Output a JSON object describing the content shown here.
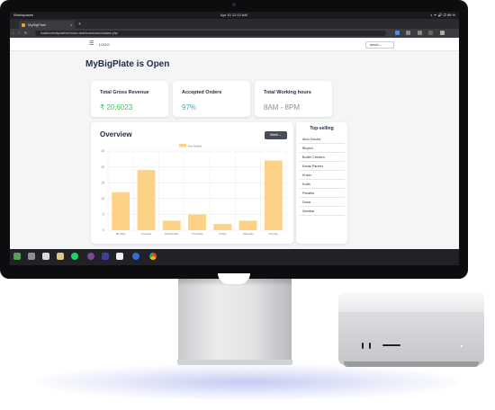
{
  "os": {
    "workspace_label": "Workspaces",
    "clock": "Apr 10  12:12 AM",
    "tray": "◐ ᯤ 🔊 ⏻ 98 %"
  },
  "browser": {
    "tab_title": "MyBigPlate",
    "new_tab": "+",
    "close_tab": "x",
    "nav_buttons": "‹ › ↻",
    "url": "localhost/mbp/admin/index-dashboard/admin/sales.php"
  },
  "app": {
    "logo": "LOGO",
    "admin_label": "admin",
    "page_title": "MyBigPlate is Open",
    "cards": [
      {
        "title": "Total Gross Revenue",
        "value": "₹ 20,6023",
        "color": "#35c55a"
      },
      {
        "title": "Accepted Orders",
        "value": "97%",
        "color": "#2fb8c9"
      },
      {
        "title": "Total Working hours",
        "value": "8AM - 8PM",
        "color": "#8a8f99"
      }
    ],
    "overview_title": "Overview",
    "week_button": "Week",
    "top_selling_title": "Top-selling",
    "top_selling": [
      "Aloo Kulcha",
      "Biryani",
      "Butter Chicken",
      "Kadai Paneer",
      "Kheer",
      "Kulfa",
      "Paratha",
      "Dosa",
      "Sambar"
    ]
  },
  "chart_data": {
    "type": "bar",
    "categories": [
      "Monday",
      "Tuesday",
      "Wednesday",
      "Thursday",
      "Friday",
      "Saturday",
      "Sunday"
    ],
    "series": [
      {
        "name": "# of Orders",
        "values": [
          12,
          19,
          3,
          5,
          2,
          3,
          22
        ]
      }
    ],
    "ylim": [
      0,
      25
    ],
    "yticks": [
      0,
      5,
      10,
      15,
      20,
      25
    ],
    "bar_color": "#fdd287",
    "grid": true,
    "legend": "top-center"
  },
  "dock": {
    "apps": [
      "grid-icon",
      "files-icon",
      "screenshot-icon",
      "folder-icon",
      "spotify-icon",
      "tor-icon",
      "studio-icon",
      "document-icon",
      "browser-icon",
      "chrome-icon"
    ]
  }
}
